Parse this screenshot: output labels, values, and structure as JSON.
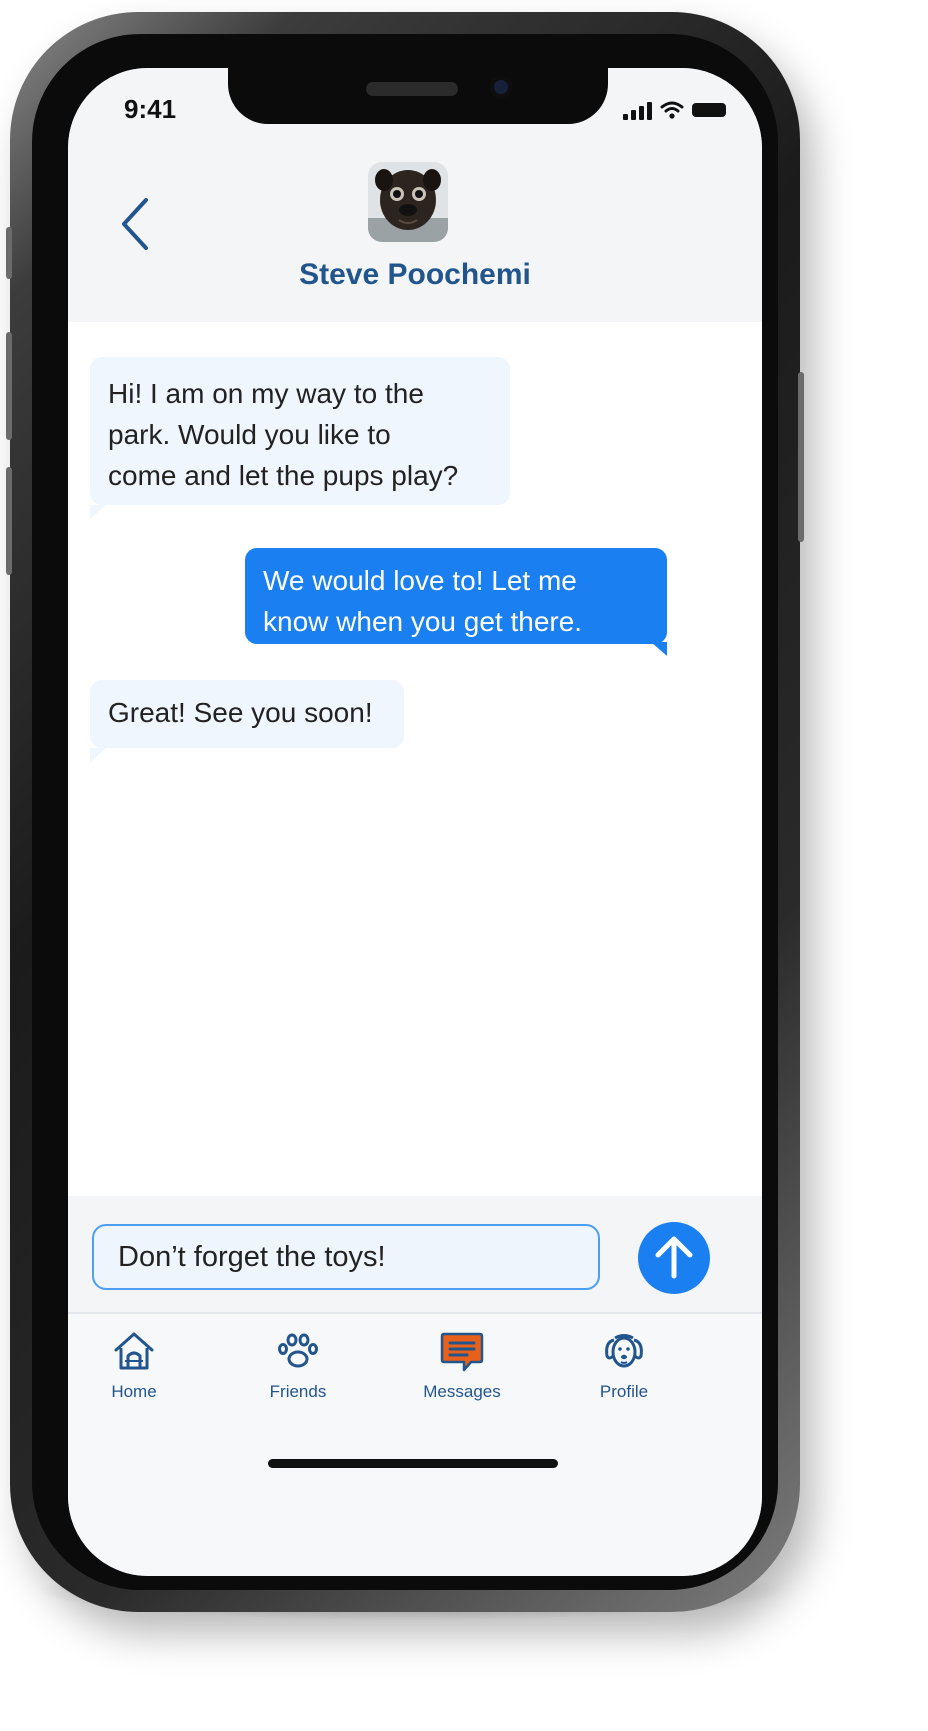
{
  "status_bar": {
    "time": "9:41"
  },
  "header": {
    "contact_name": "Steve Poochemi",
    "back_icon": "chevron-left-icon",
    "avatar_alt": "dog-avatar"
  },
  "messages": [
    {
      "direction": "incoming",
      "lines": [
        "Hi! I am on my way to the",
        "park. Would you like to",
        "come and let the pups play?"
      ]
    },
    {
      "direction": "outgoing",
      "lines": [
        "We would love to! Let me",
        "know when you get there."
      ]
    },
    {
      "direction": "incoming",
      "lines": [
        "Great! See you soon!"
      ]
    }
  ],
  "composer": {
    "value": "Don’t forget the toys!",
    "send_icon": "arrow-up-icon"
  },
  "tabs": [
    {
      "label": "Home",
      "icon": "house-icon",
      "active": false
    },
    {
      "label": "Friends",
      "icon": "paw-icon",
      "active": false
    },
    {
      "label": "Messages",
      "icon": "chat-icon",
      "active": true
    },
    {
      "label": "Profile",
      "icon": "dog-face-icon",
      "active": false
    }
  ],
  "colors": {
    "accent": "#1a7ff0",
    "brand_text": "#22558c",
    "active_tab": "#e8611c",
    "incoming_bubble": "#f0f6fd"
  }
}
